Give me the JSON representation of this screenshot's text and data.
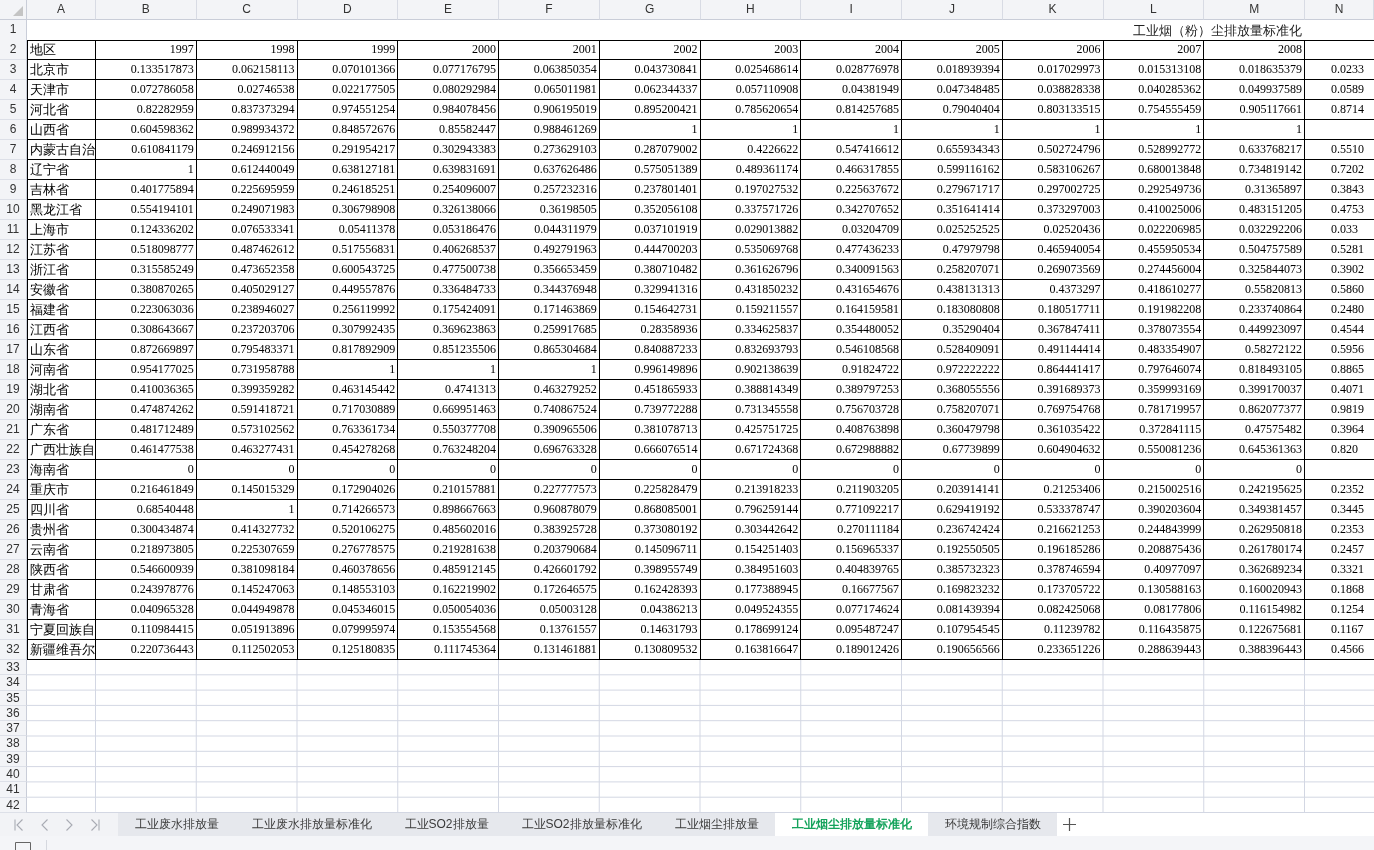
{
  "column_headers": [
    "A",
    "B",
    "C",
    "D",
    "E",
    "F",
    "G",
    "H",
    "I",
    "J",
    "K",
    "L",
    "M",
    "N"
  ],
  "title_row": {
    "number": "1",
    "title": "工业烟（粉）尘排放量标准化"
  },
  "header_row": {
    "number": "2",
    "label": "地区",
    "years": [
      "1997",
      "1998",
      "1999",
      "2000",
      "2001",
      "2002",
      "2003",
      "2004",
      "2005",
      "2006",
      "2007",
      "2008"
    ]
  },
  "rows": [
    {
      "number": "3",
      "region": "北京市",
      "values": [
        "0.133517873",
        "0.062158113",
        "0.070101366",
        "0.077176795",
        "0.063850354",
        "0.043730841",
        "0.025468614",
        "0.028776978",
        "0.018939394",
        "0.017029973",
        "0.015313108",
        "0.018635379"
      ],
      "column_n": "0.0233"
    },
    {
      "number": "4",
      "region": "天津市",
      "values": [
        "0.072786058",
        "0.02746538",
        "0.022177505",
        "0.080292984",
        "0.065011981",
        "0.062344337",
        "0.057110908",
        "0.04381949",
        "0.047348485",
        "0.038828338",
        "0.040285362",
        "0.049937589"
      ],
      "column_n": "0.0589"
    },
    {
      "number": "5",
      "region": "河北省",
      "values": [
        "0.82282959",
        "0.837373294",
        "0.974551254",
        "0.984078456",
        "0.906195019",
        "0.895200421",
        "0.785620654",
        "0.814257685",
        "0.79040404",
        "0.803133515",
        "0.754555459",
        "0.905117661"
      ],
      "column_n": "0.8714"
    },
    {
      "number": "6",
      "region": "山西省",
      "values": [
        "0.604598362",
        "0.989934372",
        "0.848572676",
        "0.85582447",
        "0.988461269",
        "1",
        "1",
        "1",
        "1",
        "1",
        "1",
        "1"
      ]
    },
    {
      "number": "7",
      "region": "内蒙古自治",
      "values": [
        "0.610841179",
        "0.246912156",
        "0.291954217",
        "0.302943383",
        "0.273629103",
        "0.287079002",
        "0.4226622",
        "0.547416612",
        "0.655934343",
        "0.502724796",
        "0.528992772",
        "0.633768217"
      ],
      "column_n": "0.5510"
    },
    {
      "number": "8",
      "region": "辽宁省",
      "values": [
        "1",
        "0.612440049",
        "0.638127181",
        "0.639831691",
        "0.637626486",
        "0.575051389",
        "0.489361174",
        "0.466317855",
        "0.599116162",
        "0.583106267",
        "0.680013848",
        "0.734819142"
      ],
      "column_n": "0.7202"
    },
    {
      "number": "9",
      "region": "吉林省",
      "values": [
        "0.401775894",
        "0.225695959",
        "0.246185251",
        "0.254096007",
        "0.257232316",
        "0.237801401",
        "0.197027532",
        "0.225637672",
        "0.279671717",
        "0.297002725",
        "0.292549736",
        "0.31365897"
      ],
      "column_n": "0.3843"
    },
    {
      "number": "10",
      "region": "黑龙江省",
      "values": [
        "0.554194101",
        "0.249071983",
        "0.306798908",
        "0.326138066",
        "0.36198505",
        "0.352056108",
        "0.337571726",
        "0.342707652",
        "0.351641414",
        "0.373297003",
        "0.410025006",
        "0.483151205"
      ],
      "column_n": "0.4753"
    },
    {
      "number": "11",
      "region": "上海市",
      "values": [
        "0.124336202",
        "0.076533341",
        "0.05411378",
        "0.053186476",
        "0.044311979",
        "0.037101919",
        "0.029013882",
        "0.03204709",
        "0.025252525",
        "0.02520436",
        "0.022206985",
        "0.032292206"
      ],
      "column_n": "0.033"
    },
    {
      "number": "12",
      "region": "江苏省",
      "values": [
        "0.518098777",
        "0.487462612",
        "0.517556831",
        "0.406268537",
        "0.492791963",
        "0.444700203",
        "0.535069768",
        "0.477436233",
        "0.47979798",
        "0.465940054",
        "0.455950534",
        "0.504757589"
      ],
      "column_n": "0.5281"
    },
    {
      "number": "13",
      "region": "浙江省",
      "values": [
        "0.315585249",
        "0.473652358",
        "0.600543725",
        "0.477500738",
        "0.356653459",
        "0.380710482",
        "0.361626796",
        "0.340091563",
        "0.258207071",
        "0.269073569",
        "0.274456004",
        "0.325844073"
      ],
      "column_n": "0.3902"
    },
    {
      "number": "14",
      "region": "安徽省",
      "values": [
        "0.380870265",
        "0.405029127",
        "0.449557876",
        "0.336484733",
        "0.344376948",
        "0.329941316",
        "0.431850232",
        "0.431654676",
        "0.438131313",
        "0.4373297",
        "0.418610277",
        "0.55820813"
      ],
      "column_n": "0.5860"
    },
    {
      "number": "15",
      "region": "福建省",
      "values": [
        "0.223063036",
        "0.238946027",
        "0.256119992",
        "0.175424091",
        "0.171463869",
        "0.154642731",
        "0.159211557",
        "0.164159581",
        "0.183080808",
        "0.180517711",
        "0.191982208",
        "0.233740864"
      ],
      "column_n": "0.2480"
    },
    {
      "number": "16",
      "region": "江西省",
      "values": [
        "0.308643667",
        "0.237203706",
        "0.307992435",
        "0.369623863",
        "0.259917685",
        "0.28358936",
        "0.334625837",
        "0.354480052",
        "0.35290404",
        "0.367847411",
        "0.378073554",
        "0.449923097"
      ],
      "column_n": "0.4544"
    },
    {
      "number": "17",
      "region": "山东省",
      "values": [
        "0.872669897",
        "0.795483371",
        "0.817892909",
        "0.851235506",
        "0.865304684",
        "0.840887233",
        "0.832693793",
        "0.546108568",
        "0.528409091",
        "0.491144414",
        "0.483354907",
        "0.58272122"
      ],
      "column_n": "0.5956"
    },
    {
      "number": "18",
      "region": "河南省",
      "values": [
        "0.954177025",
        "0.731958788",
        "1",
        "1",
        "1",
        "0.996149896",
        "0.902138639",
        "0.91824722",
        "0.972222222",
        "0.864441417",
        "0.797646074",
        "0.818493105"
      ],
      "column_n": "0.8865"
    },
    {
      "number": "19",
      "region": "湖北省",
      "values": [
        "0.410036365",
        "0.399359282",
        "0.463145442",
        "0.4741313",
        "0.463279252",
        "0.451865933",
        "0.388814349",
        "0.389797253",
        "0.368055556",
        "0.391689373",
        "0.359993169",
        "0.399170037"
      ],
      "column_n": "0.4071"
    },
    {
      "number": "20",
      "region": "湖南省",
      "values": [
        "0.474874262",
        "0.591418721",
        "0.717030889",
        "0.669951463",
        "0.740867524",
        "0.739772288",
        "0.731345558",
        "0.756703728",
        "0.758207071",
        "0.769754768",
        "0.781719957",
        "0.862077377"
      ],
      "column_n": "0.9819"
    },
    {
      "number": "21",
      "region": "广东省",
      "values": [
        "0.481712489",
        "0.573102562",
        "0.763361734",
        "0.550377708",
        "0.390965506",
        "0.381078713",
        "0.425751725",
        "0.408763898",
        "0.360479798",
        "0.361035422",
        "0.372841115",
        "0.47575482"
      ],
      "column_n": "0.3964"
    },
    {
      "number": "22",
      "region": "广西壮族自",
      "values": [
        "0.461477538",
        "0.463277431",
        "0.454278268",
        "0.763248204",
        "0.696763328",
        "0.666076514",
        "0.671724368",
        "0.672988882",
        "0.67739899",
        "0.604904632",
        "0.550081236",
        "0.645361363"
      ],
      "column_n": "0.820"
    },
    {
      "number": "23",
      "region": "海南省",
      "values": [
        "0",
        "0",
        "0",
        "0",
        "0",
        "0",
        "0",
        "0",
        "0",
        "0",
        "0",
        "0"
      ]
    },
    {
      "number": "24",
      "region": "重庆市",
      "values": [
        "0.216461849",
        "0.145015329",
        "0.172904026",
        "0.210157881",
        "0.227777573",
        "0.225828479",
        "0.213918233",
        "0.211903205",
        "0.203914141",
        "0.21253406",
        "0.215002516",
        "0.242195625"
      ],
      "column_n": "0.2352"
    },
    {
      "number": "25",
      "region": "四川省",
      "values": [
        "0.68540448",
        "1",
        "0.714266573",
        "0.898667663",
        "0.960878079",
        "0.868085001",
        "0.796259144",
        "0.771092217",
        "0.629419192",
        "0.533378747",
        "0.390203604",
        "0.349381457"
      ],
      "column_n": "0.3445"
    },
    {
      "number": "26",
      "region": "贵州省",
      "values": [
        "0.300434874",
        "0.414327732",
        "0.520106275",
        "0.485602016",
        "0.383925728",
        "0.373080192",
        "0.303442642",
        "0.270111184",
        "0.236742424",
        "0.216621253",
        "0.244843999",
        "0.262950818"
      ],
      "column_n": "0.2353"
    },
    {
      "number": "27",
      "region": "云南省",
      "values": [
        "0.218973805",
        "0.225307659",
        "0.276778575",
        "0.219281638",
        "0.203790684",
        "0.145096711",
        "0.154251403",
        "0.156965337",
        "0.192550505",
        "0.196185286",
        "0.208875436",
        "0.261780174"
      ],
      "column_n": "0.2457"
    },
    {
      "number": "28",
      "region": "陕西省",
      "values": [
        "0.546600939",
        "0.381098184",
        "0.460378656",
        "0.485912145",
        "0.426601792",
        "0.398955749",
        "0.384951603",
        "0.404839765",
        "0.385732323",
        "0.378746594",
        "0.40977097",
        "0.362689234"
      ],
      "column_n": "0.3321"
    },
    {
      "number": "29",
      "region": "甘肃省",
      "values": [
        "0.243978776",
        "0.145247063",
        "0.148553103",
        "0.162219902",
        "0.172646575",
        "0.162428393",
        "0.177388945",
        "0.16677567",
        "0.169823232",
        "0.173705722",
        "0.130588163",
        "0.160020943"
      ],
      "column_n": "0.1868"
    },
    {
      "number": "30",
      "region": "青海省",
      "values": [
        "0.040965328",
        "0.044949878",
        "0.045346015",
        "0.050054036",
        "0.05003128",
        "0.04386213",
        "0.049524355",
        "0.077174624",
        "0.081439394",
        "0.082425068",
        "0.08177806",
        "0.116154982"
      ],
      "column_n": "0.1254"
    },
    {
      "number": "31",
      "region": "宁夏回族自",
      "values": [
        "0.110984415",
        "0.051913896",
        "0.079995974",
        "0.153554568",
        "0.13761557",
        "0.14631793",
        "0.178699124",
        "0.095487247",
        "0.107954545",
        "0.11239782",
        "0.116435875",
        "0.122675681"
      ],
      "column_n": "0.1167"
    },
    {
      "number": "32",
      "region": "新疆维吾尔",
      "values": [
        "0.220736443",
        "0.112502053",
        "0.125180835",
        "0.111745364",
        "0.131461881",
        "0.130809532",
        "0.163816647",
        "0.189012426",
        "0.190656566",
        "0.233651226",
        "0.288639443",
        "0.388396443"
      ],
      "column_n": "0.4566"
    }
  ],
  "empty_rows": [
    "33",
    "34",
    "35",
    "36",
    "37",
    "38",
    "39",
    "40",
    "41",
    "42"
  ],
  "sheet_tabs": [
    {
      "label": "工业废水排放量",
      "selected": false
    },
    {
      "label": "工业废水排放量标准化",
      "selected": false
    },
    {
      "label": "工业SO2排放量",
      "selected": false
    },
    {
      "label": "工业SO2排放量标准化",
      "selected": false
    },
    {
      "label": "工业烟尘排放量",
      "selected": false
    },
    {
      "label": "工业烟尘排放量标准化",
      "selected": true
    },
    {
      "label": "环境规制综合指数",
      "selected": false
    }
  ]
}
